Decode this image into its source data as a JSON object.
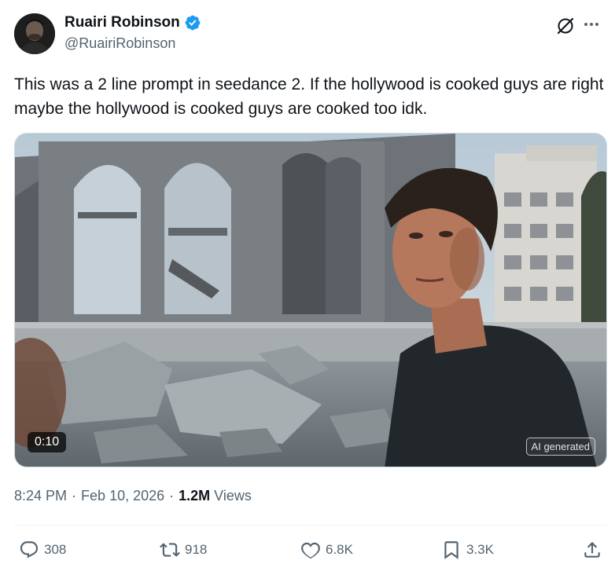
{
  "author": {
    "name": "Ruairi Robinson",
    "handle": "@RuairiRobinson",
    "verified": true
  },
  "tweet": {
    "text": "This was a 2 line prompt in seedance 2. If the hollywood is cooked guys are right maybe the hollywood is cooked guys are cooked too idk."
  },
  "media": {
    "duration": "0:10",
    "badge": "AI generated"
  },
  "meta": {
    "time": "8:24 PM",
    "dot1": "·",
    "date": "Feb 10, 2026",
    "dot2": "·",
    "views_count": "1.2M",
    "views_label": "Views"
  },
  "actions": {
    "replies": "308",
    "reposts": "918",
    "likes": "6.8K",
    "bookmarks": "3.3K"
  },
  "colors": {
    "verified": "#1d9bf0",
    "text": "#0f1419",
    "secondary": "#536471"
  },
  "icons": [
    "verified-icon",
    "grok-icon",
    "more-icon",
    "reply-icon",
    "repost-icon",
    "like-icon",
    "bookmark-icon",
    "share-icon"
  ]
}
